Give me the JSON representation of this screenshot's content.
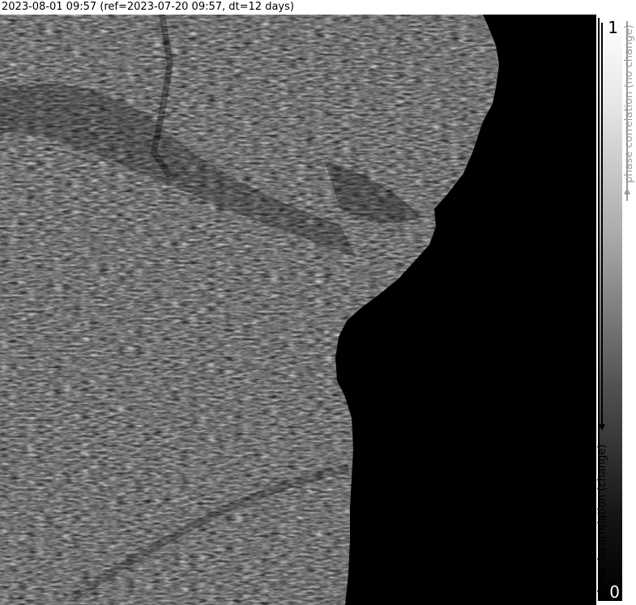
{
  "title": "2023-08-01 09:57 (ref=2023-07-20 09:57, dt=12 days)",
  "colorbar": {
    "max_label": "1",
    "min_label": "0",
    "top_caption": "phase correlation (no change)",
    "bottom_caption": "phase decorrelation (change)",
    "colormap": "grayscale",
    "range": [
      0,
      1
    ]
  }
}
